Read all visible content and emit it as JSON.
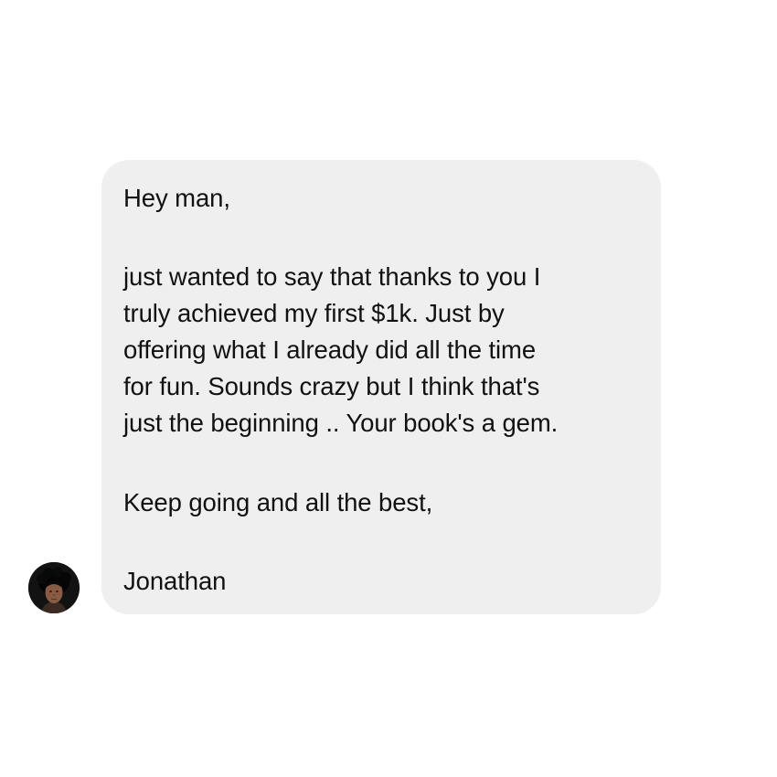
{
  "message": {
    "greeting": "Hey man,",
    "body_lines": [
      "just wanted to say that thanks to you I",
      "truly achieved my first $1k. Just by",
      "offering what I already did all the time",
      "for fun. Sounds crazy but I think that's",
      "just the beginning .. Your book's a gem."
    ],
    "closing": "Keep going and all the best,",
    "signature": "Jonathan"
  },
  "sender": {
    "avatar_icon": "profile-photo-avatar"
  },
  "colors": {
    "background": "#ffffff",
    "bubble": "#efefef",
    "text": "#111111"
  }
}
